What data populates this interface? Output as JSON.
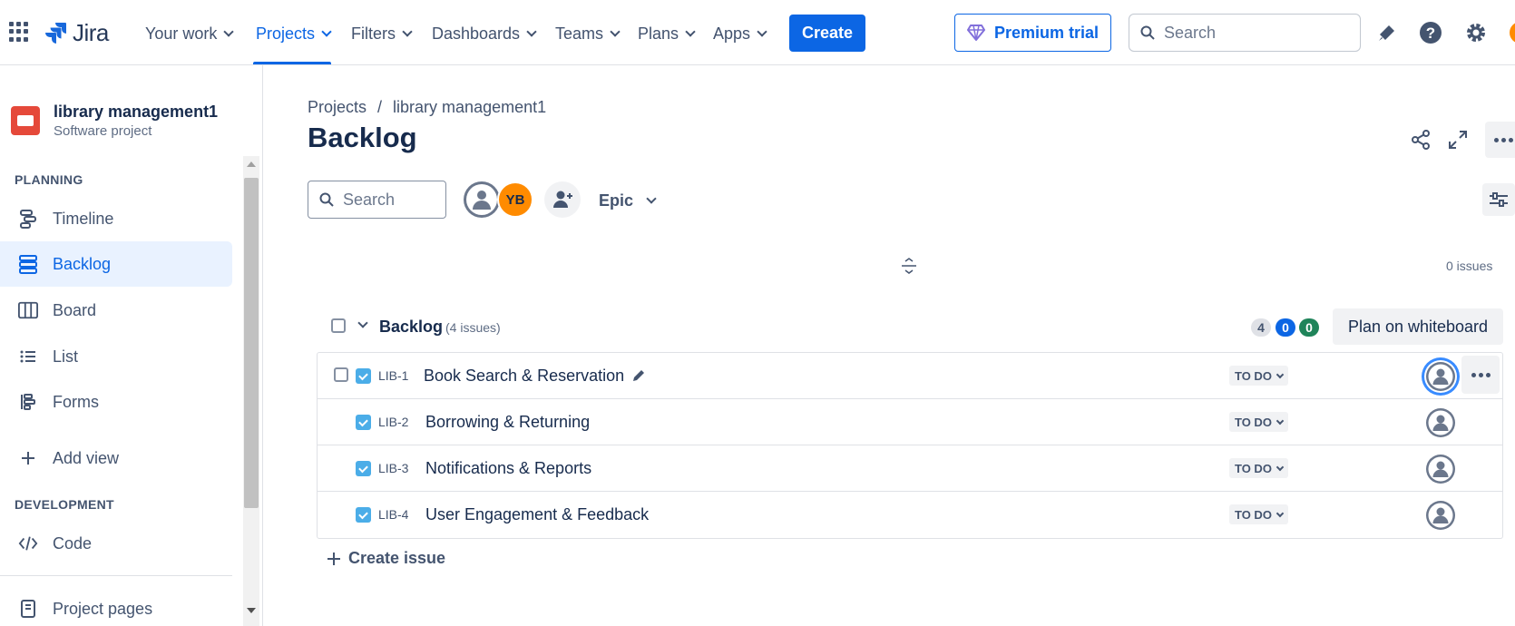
{
  "app": {
    "name": "Jira"
  },
  "nav": {
    "items": [
      {
        "label": "Your work"
      },
      {
        "label": "Projects"
      },
      {
        "label": "Filters"
      },
      {
        "label": "Dashboards"
      },
      {
        "label": "Teams"
      },
      {
        "label": "Plans"
      },
      {
        "label": "Apps"
      }
    ],
    "create_label": "Create",
    "premium_label": "Premium trial",
    "search_placeholder": "Search"
  },
  "sidebar": {
    "project_name": "library management1",
    "project_type": "Software project",
    "planning_heading": "PLANNING",
    "items": [
      {
        "label": "Timeline",
        "icon": "timeline-icon"
      },
      {
        "label": "Backlog",
        "icon": "backlog-icon"
      },
      {
        "label": "Board",
        "icon": "board-icon"
      },
      {
        "label": "List",
        "icon": "list-icon"
      },
      {
        "label": "Forms",
        "icon": "forms-icon"
      },
      {
        "label": "Add view",
        "icon": "plus-icon"
      }
    ],
    "development_heading": "DEVELOPMENT",
    "code_label": "Code",
    "project_pages_label": "Project pages"
  },
  "breadcrumb": {
    "root": "Projects",
    "separator": "/",
    "project": "library management1"
  },
  "page_title": "Backlog",
  "toolbar": {
    "search_placeholder": "Search",
    "avatar_initials": "YB",
    "epic_label": "Epic"
  },
  "issue_count_label": "0 issues",
  "backlog": {
    "title": "Backlog",
    "count_label": "(4 issues)",
    "pill_total": "4",
    "pill_in_progress": "0",
    "pill_done": "0",
    "whiteboard_label": "Plan on whiteboard",
    "issues": [
      {
        "key": "LIB-1",
        "summary": "Book Search & Reservation",
        "status": "TO DO"
      },
      {
        "key": "LIB-2",
        "summary": "Borrowing & Returning",
        "status": "TO DO"
      },
      {
        "key": "LIB-3",
        "summary": "Notifications & Reports",
        "status": "TO DO"
      },
      {
        "key": "LIB-4",
        "summary": "User Engagement & Feedback",
        "status": "TO DO"
      }
    ],
    "create_issue_label": "Create issue"
  },
  "colors": {
    "accent": "#0c66e4",
    "project_avatar": "#e5493a",
    "avatar_yb": "#ff8b00",
    "issue_type": "#4bade8",
    "pill_done": "#1f845a"
  }
}
